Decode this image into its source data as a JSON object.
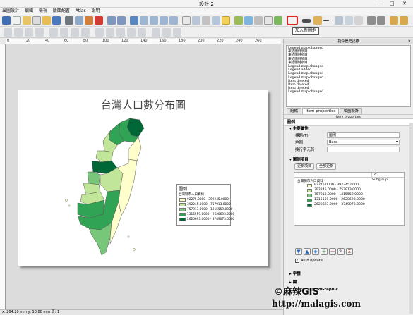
{
  "window": {
    "title": "設計 2"
  },
  "menu": [
    "出圖設計",
    "編輯",
    "檢視",
    "版面配置",
    "Atlas",
    "說明"
  ],
  "toolbar": {
    "tooltip": "加入新圖例",
    "highlighted": "add-legend-button"
  },
  "ruler": {
    "top_labels": [
      "0",
      "20",
      "40",
      "60",
      "80",
      "100",
      "120",
      "140",
      "160",
      "180",
      "200",
      "220",
      "240",
      "260"
    ]
  },
  "map": {
    "title": "台灣人口數分布圖",
    "legend": {
      "title": "圖例",
      "layer": "台灣縣市人口資料",
      "classes": [
        {
          "label": "92275.0000 - 392245.0000",
          "color": "#ffffcc"
        },
        {
          "label": "392245.0000 - 757913.0000",
          "color": "#c2e699"
        },
        {
          "label": "757913.0000 - 1315559.0000",
          "color": "#78c679"
        },
        {
          "label": "1315559.0000 - 2620693.0000",
          "color": "#31a354"
        },
        {
          "label": "2620693.0000 - 3749073.0000",
          "color": "#006837"
        }
      ]
    }
  },
  "history": {
    "title": "指令歷史記錄",
    "entries": [
      "Legend map changed",
      "凍結圖例項目",
      "凍結圖例項目",
      "凍結圖例項目",
      "凍結圖例項目",
      "Legend map changed",
      "Legend added",
      "Legend map changed",
      "Legend map changed",
      "Item deleted",
      "Item deleted",
      "Item deleted",
      "Legend map changed"
    ]
  },
  "panel": {
    "tabs": [
      "組成",
      "Item properties",
      "項圖設計"
    ],
    "subheader": "Item properties",
    "item_type": "圖例",
    "main_section": "主要屬性",
    "title_label": "標題(T)",
    "title_value": "圖例",
    "map_label": "地圖",
    "map_value": "Base",
    "wrap_label": "換行字元符",
    "wrap_value": "",
    "items_section": "圖例項目",
    "update_all": "更新項目",
    "update_btn": "全部更新",
    "tree_col1": "1",
    "tree_col2": "2",
    "tree_col2_label": "Subgroup",
    "tree_layer": "台灣縣市人口資料",
    "auto_update": "Auto update",
    "collapsed_sections": [
      "字體",
      "欄",
      "WMS LegendGraphic"
    ]
  },
  "status": {
    "text": "x: 264.20 mm  y: 10.88 mm  頁: 1"
  },
  "watermark": {
    "line1": "©麻辣GIS",
    "line2": "http://malagis.com"
  }
}
